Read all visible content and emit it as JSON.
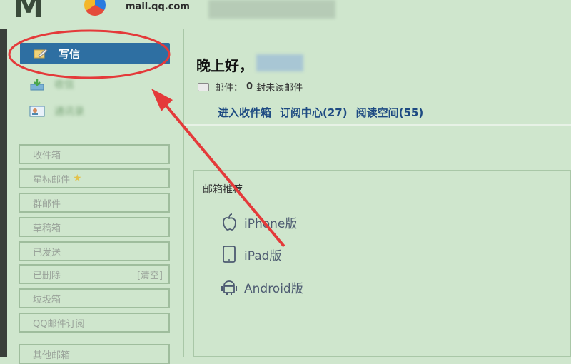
{
  "header": {
    "logo_text": "mail.qq.com"
  },
  "sidebar": {
    "write_label": "写信",
    "blurred_links": [
      "收信",
      "通讯录"
    ],
    "folders": [
      {
        "label": "收件箱"
      },
      {
        "label": "星标邮件",
        "icon": "star-icon"
      },
      {
        "label": "群邮件"
      },
      {
        "label": "草稿箱"
      },
      {
        "label": "已发送"
      },
      {
        "label": "已删除",
        "extra": "[清空]"
      },
      {
        "label": "垃圾箱"
      },
      {
        "label": "QQ邮件订阅"
      },
      {
        "label": "其他邮箱"
      }
    ]
  },
  "main": {
    "greeting": "晚上好，",
    "mail_prefix": "邮件：",
    "unread_count": "0",
    "mail_suffix": "封未读邮件",
    "links": [
      "进入收件箱",
      "订阅中心(27)",
      "阅读空间(55)"
    ],
    "panel_title": "邮箱推荐",
    "apps": [
      {
        "label": "iPhone版",
        "icon": "apple-icon"
      },
      {
        "label": "iPad版",
        "icon": "tablet-icon"
      },
      {
        "label": "Android版",
        "icon": "android-icon"
      }
    ]
  },
  "colors": {
    "background": "#cfe6cd",
    "write_button": "#2e6fa2",
    "annotation_red": "#e43a3a",
    "link": "#1d4a82"
  }
}
